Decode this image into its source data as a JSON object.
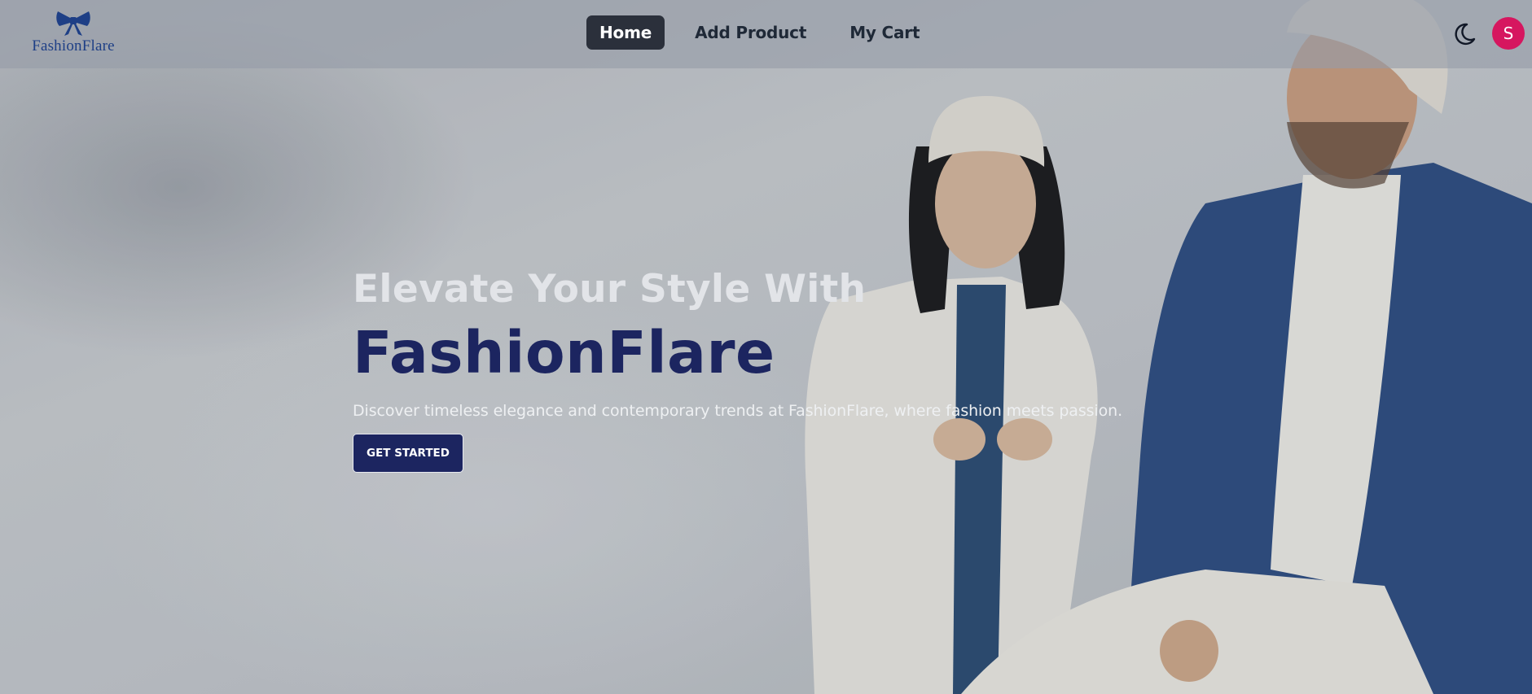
{
  "brand": {
    "name": "FashionFlare",
    "logo_icon": "bow-icon",
    "color": "#1e3f86"
  },
  "nav": {
    "items": [
      {
        "label": "Home",
        "active": true
      },
      {
        "label": "Add Product",
        "active": false
      },
      {
        "label": "My Cart",
        "active": false
      }
    ],
    "theme_toggle_icon": "moon-icon",
    "avatar_initial": "S",
    "avatar_color": "#d6165f"
  },
  "hero": {
    "headline": "Elevate Your Style With",
    "brand_headline": "FashionFlare",
    "subtitle": "Discover timeless elegance and contemporary trends at FashionFlare, where fashion meets passion.",
    "cta_label": "GET STARTED",
    "accent_color": "#1c2560"
  }
}
